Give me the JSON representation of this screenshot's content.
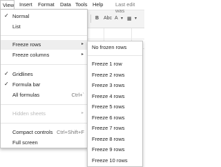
{
  "menubar": {
    "items": [
      "View",
      "Insert",
      "Format",
      "Data",
      "Tools",
      "Help"
    ],
    "last_edit": "Last edit was"
  },
  "toolbar": {
    "bold": "B",
    "font_name": "Abc",
    "text_color": "A"
  },
  "view_menu": {
    "items": [
      {
        "label": "Normal",
        "checked": true
      },
      {
        "label": "List",
        "checked": false
      },
      {
        "label": "Freeze rows",
        "submenu": true
      },
      {
        "label": "Freeze columns",
        "submenu": true
      },
      {
        "label": "Gridlines",
        "checked": true
      },
      {
        "label": "Formula bar",
        "checked": true
      },
      {
        "label": "All formulas",
        "shortcut": "Ctrl+`"
      },
      {
        "label": "Hidden sheets",
        "submenu": true,
        "disabled": true
      },
      {
        "label": "Compact controls",
        "shortcut": "Ctrl+Shift+F"
      },
      {
        "label": "Full screen"
      }
    ]
  },
  "freeze_rows_menu": {
    "items": [
      "No frozen rows",
      "Freeze 1 row",
      "Freeze 2 rows",
      "Freeze 3 rows",
      "Freeze 4 rows",
      "Freeze 5 rows",
      "Freeze 6 rows",
      "Freeze 7 rows",
      "Freeze 8 rows",
      "Freeze 9 rows",
      "Freeze 10 rows"
    ]
  },
  "icons": {
    "check": "✓",
    "submenu_arrow": "▸"
  }
}
